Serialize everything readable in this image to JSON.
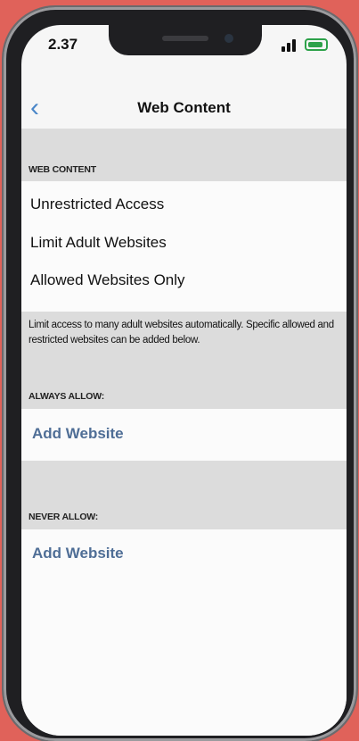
{
  "status_bar": {
    "time": "2.37"
  },
  "nav": {
    "back_glyph": "‹",
    "title": "Web Content"
  },
  "web_content": {
    "section_label": "WEB CONTENT",
    "options": [
      "Unrestricted Access",
      "Limit Adult Websites",
      "Allowed Websites Only"
    ],
    "note": "Limit access to many adult websites automatically. Specific allowed and restricted websites can be added below."
  },
  "always_allow": {
    "label": "ALWAYS ALLOW:",
    "add_link": "Add Website"
  },
  "never_allow": {
    "label": "NEVER ALLOW:",
    "add_link": "Add Website"
  },
  "colors": {
    "background": "#e0625a",
    "accent": "#4a86c8",
    "link": "#4f6e96",
    "battery": "#2ea24a"
  }
}
